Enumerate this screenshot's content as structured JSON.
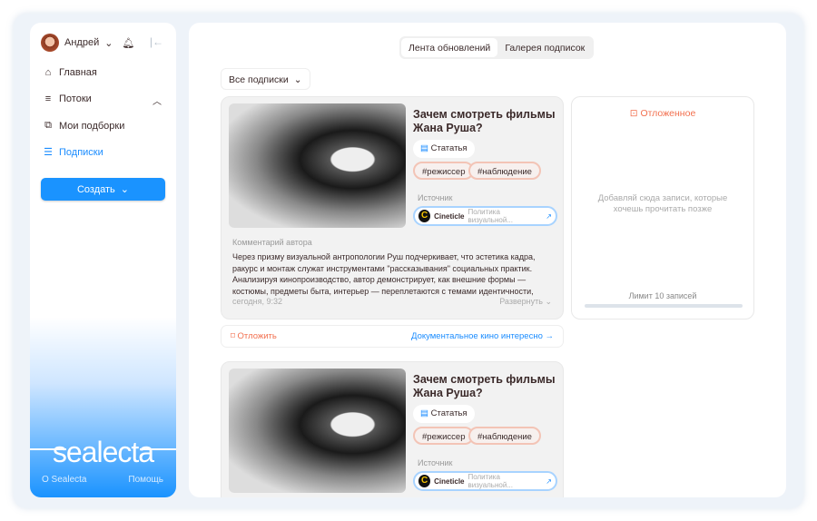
{
  "user": {
    "name": "Андрей"
  },
  "nav": [
    {
      "label": "Главная"
    },
    {
      "label": "Потоки"
    },
    {
      "label": "Мои подборки"
    },
    {
      "label": "Подписки"
    }
  ],
  "create_label": "Создать",
  "logo": "sealecta",
  "footer": {
    "about": "О Sealecta",
    "help": "Помощь"
  },
  "tabs": [
    {
      "label": "Лента обновлений"
    },
    {
      "label": "Галерея подписок"
    }
  ],
  "filter": "Все подписки",
  "posts": [
    {
      "title": "Зачем смотреть фильмы Жана Руша?",
      "type": "Стататья",
      "tags": [
        "#режиссер",
        "#наблюдение"
      ],
      "source_label": "Источник",
      "source_name": "Cineticle",
      "source_title": "Политика визуальной...",
      "comment_label": "Комментарий автора",
      "comment": "Через призму визуальной антропологии Руш подчеркивает, что эстетика кадра, ракурс и монтаж служат инструментами \"рассказывания\" социальных практик. Анализируя кинопроизводство, автор демонстрирует, как внешние формы — костюмы, предметы быта, интерьер — переплетаются с темами идентичности, класса и пола. Через призму визуальн...",
      "time": "сегодня, 9:32",
      "expand": "Развернуть",
      "later": "Отложить",
      "collection": "Документальное кино интересно"
    },
    {
      "title": "Зачем смотреть фильмы Жана Руша?",
      "type": "Стататья",
      "tags": [
        "#режиссер",
        "#наблюдение"
      ],
      "source_label": "Источник",
      "source_name": "Cineticle",
      "source_title": "Политика визуальной..."
    }
  ],
  "deferred": {
    "title": "Отложенное",
    "empty": "Добавляй сюда записи, которые хочешь прочитать позже",
    "limit": "Лимит 10 записей",
    "fill": 0
  }
}
